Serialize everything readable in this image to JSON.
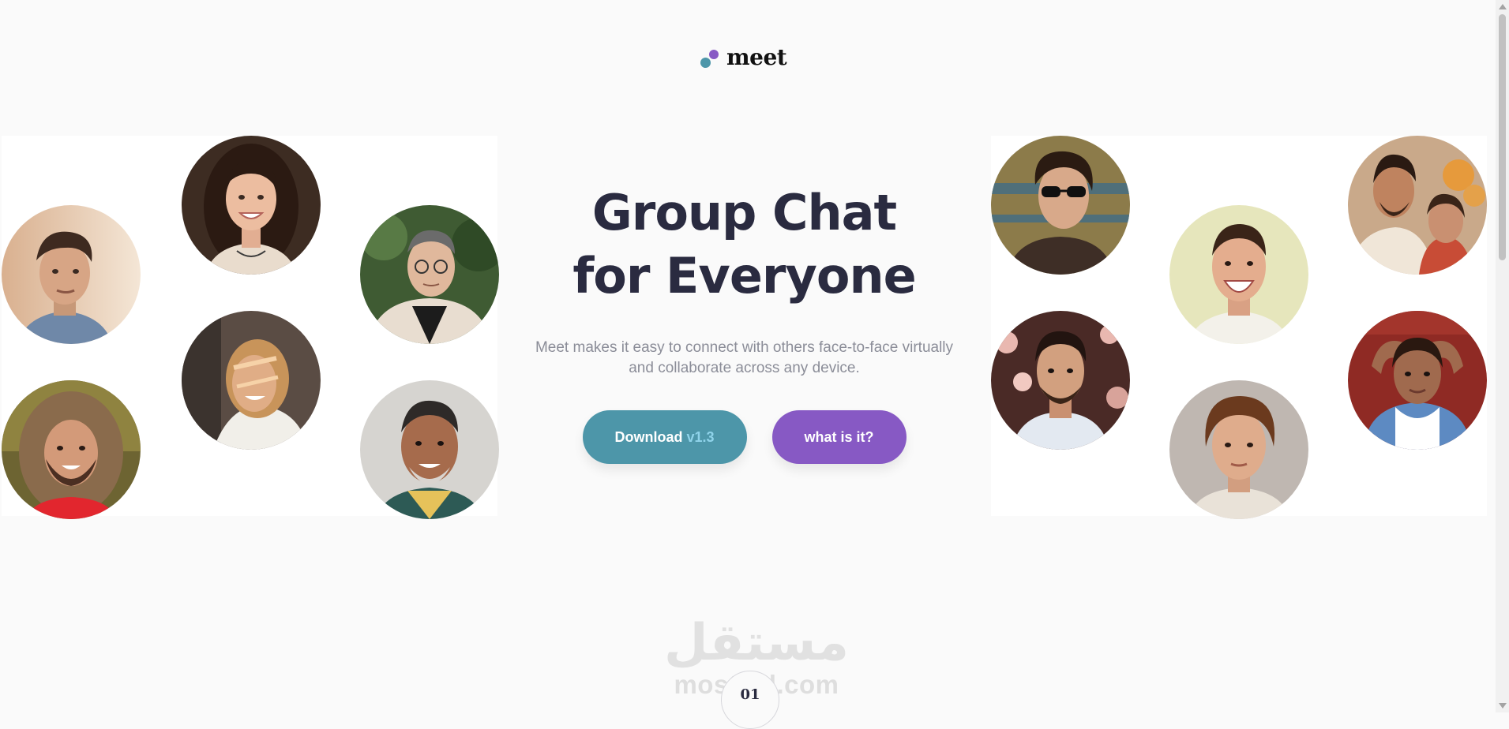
{
  "brand": {
    "name": "meet",
    "dot_primary": "#4d96a9",
    "dot_secondary": "#8759c4"
  },
  "hero": {
    "title_line1": "Group Chat",
    "title_line2": "for Everyone",
    "subtitle_line1": "Meet makes it easy to connect with others face-to-face virtually",
    "subtitle_line2": "and collaborate across any device.",
    "buttons": {
      "download_label": "Download",
      "download_version": "v1.3",
      "what_label": "what is it?"
    }
  },
  "colors": {
    "title": "#2a2b40",
    "subtitle": "#8b8d98",
    "download_bg": "#4d96a9",
    "download_version": "#8fd3ea",
    "what_bg": "#8759c4",
    "page_bg": "#fafafa"
  },
  "gallery": {
    "left_photos": [
      "portrait-young-man-curly-hair",
      "portrait-smiling-woman-dark-hair",
      "portrait-man-glasses-shearling-coat",
      "portrait-woman-laughing-sunlight",
      "portrait-man-fur-hood-red-shirt",
      "portrait-older-man-smiling"
    ],
    "right_photos": [
      "portrait-man-sunglasses",
      "portrait-man-laughing-yellow-bg",
      "portrait-couple-flowers",
      "portrait-man-blossoms",
      "portrait-woman-red-wall",
      "portrait-man-wavy-hair"
    ]
  },
  "watermark": {
    "arabic": "مستقل",
    "latin": "mostaql.com"
  },
  "step": {
    "number": "01"
  }
}
